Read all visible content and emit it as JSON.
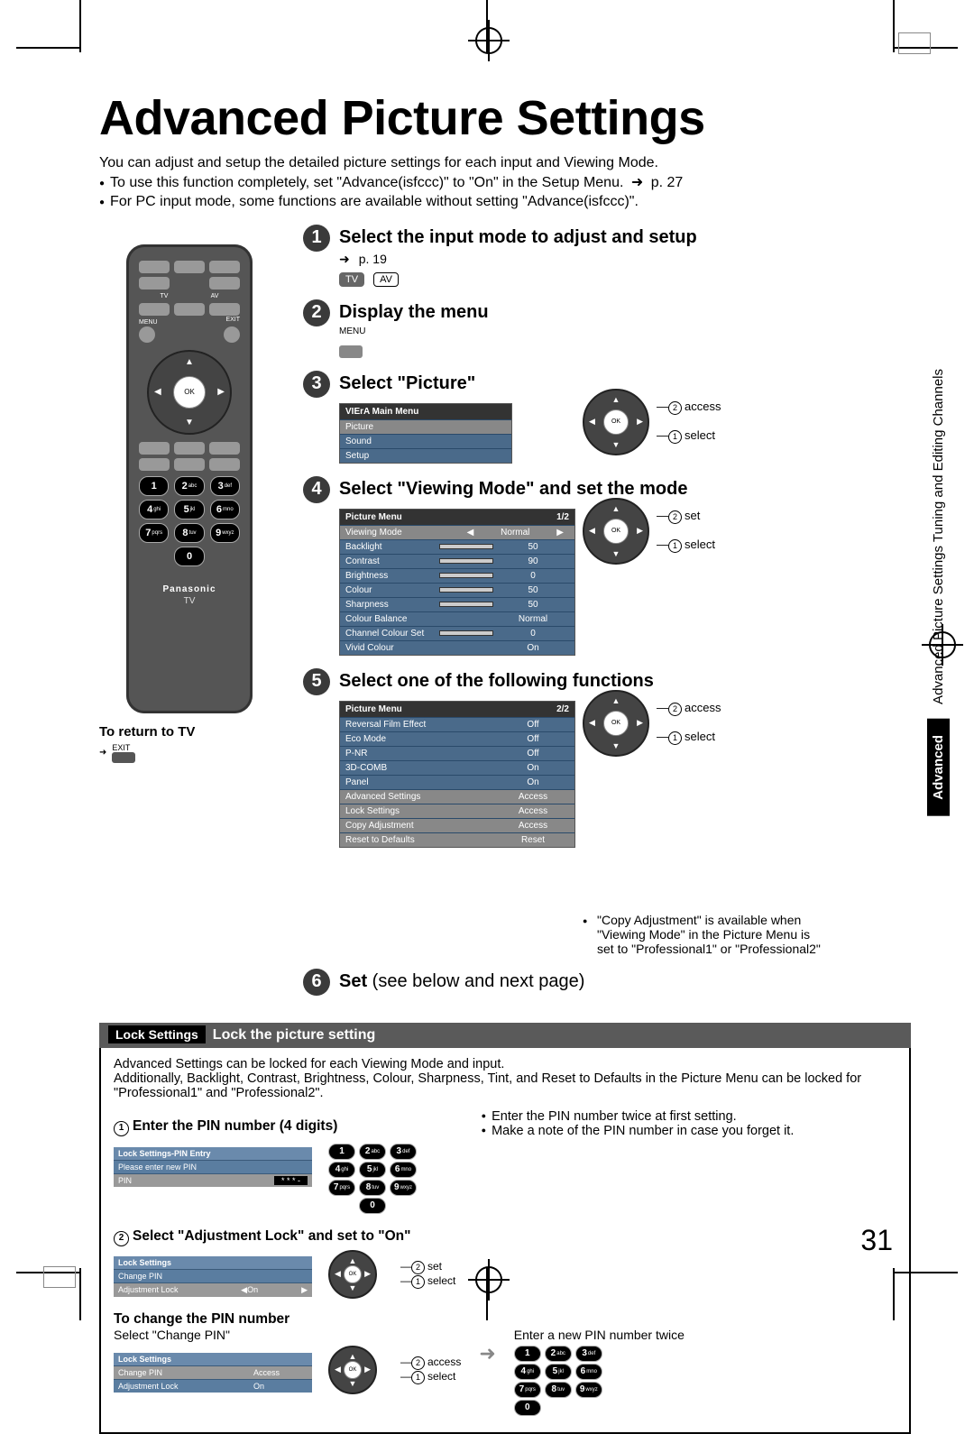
{
  "page_number": "31",
  "title": "Advanced Picture Settings",
  "intro": {
    "line1": "You can adjust and setup the detailed picture settings for each input and Viewing Mode.",
    "line2a": "To use this function completely, set \"Advance(isfccc)\" to \"On\" in the Setup Menu.",
    "line2b": "p. 27",
    "line3": "For PC input mode, some functions are available without setting \"Advance(isfccc)\"."
  },
  "side_tabs": {
    "t1": "Tuning and Editing Channels",
    "t2": "Advanced Picture Settings",
    "t3": "Advanced"
  },
  "remote": {
    "brand": "Panasonic",
    "model": "TV",
    "ok": "OK",
    "tv": "TV",
    "av": "AV",
    "menu": "MENU",
    "exit": "EXIT",
    "keys": [
      "1",
      "2abc",
      "3def",
      "4ghi",
      "5jkl",
      "6mno",
      "7pqrs",
      "8tuv",
      "9wxyz",
      "0"
    ],
    "return_label": "To return to TV",
    "exit_label": "EXIT"
  },
  "steps": {
    "s1": {
      "title": "Select the input mode to adjust and setup",
      "ref": "p. 19",
      "tv": "TV",
      "av": "AV"
    },
    "s2": {
      "title": "Display the menu",
      "menu": "MENU"
    },
    "s3": {
      "title": "Select \"Picture\"",
      "menu_title": "VIErA Main Menu",
      "items": [
        "Picture",
        "Sound",
        "Setup"
      ],
      "note_access": "access",
      "note_select": "select"
    },
    "s4": {
      "title": "Select \"Viewing Mode\" and set the mode",
      "menu_title": "Picture Menu",
      "page": "1/2",
      "rows": [
        {
          "k": "Viewing Mode",
          "v": "Normal",
          "sel": true
        },
        {
          "k": "Backlight",
          "v": "50"
        },
        {
          "k": "Contrast",
          "v": "90"
        },
        {
          "k": "Brightness",
          "v": "0"
        },
        {
          "k": "Colour",
          "v": "50"
        },
        {
          "k": "Sharpness",
          "v": "50"
        },
        {
          "k": "Colour Balance",
          "v": "Normal"
        },
        {
          "k": "Channel Colour Set",
          "v": "0"
        },
        {
          "k": "Vivid Colour",
          "v": "On"
        }
      ],
      "note_set": "set",
      "note_select": "select"
    },
    "s5": {
      "title": "Select one of the following functions",
      "menu_title": "Picture Menu",
      "page": "2/2",
      "rows": [
        {
          "k": "Reversal Film Effect",
          "v": "Off"
        },
        {
          "k": "Eco Mode",
          "v": "Off"
        },
        {
          "k": "P-NR",
          "v": "Off"
        },
        {
          "k": "3D-COMB",
          "v": "On"
        },
        {
          "k": "Panel",
          "v": "On"
        },
        {
          "k": "Advanced Settings",
          "v": "Access"
        },
        {
          "k": "Lock Settings",
          "v": "Access"
        },
        {
          "k": "Copy Adjustment",
          "v": "Access"
        },
        {
          "k": "Reset to Defaults",
          "v": "Reset"
        }
      ],
      "note_access": "access",
      "note_select": "select",
      "copy_note": "\"Copy Adjustment\" is available when \"Viewing Mode\" in the Picture Menu is set to \"Professional1\" or \"Professional2\""
    },
    "s6": {
      "title_a": "Set",
      "title_b": " (see below and next page)"
    }
  },
  "lock": {
    "tag": "Lock Settings",
    "title": "Lock the picture setting",
    "p1": "Advanced Settings can be locked for each Viewing Mode and input.",
    "p2": "Additionally, Backlight, Contrast, Brightness, Colour, Sharpness, Tint, and Reset to Defaults in the Picture Menu can be locked for \"Professional1\" and \"Professional2\".",
    "step1": "Enter the PIN number (4 digits)",
    "pin_box_title": "Lock Settings-PIN Entry",
    "pin_prompt": "Please enter new PIN",
    "pin_label": "PIN",
    "pin_mask": "* * * -",
    "bul1": "Enter the PIN number twice at first setting.",
    "bul2": "Make a note of the PIN number in case you forget it.",
    "step2": "Select \"Adjustment Lock\" and set to \"On\"",
    "ls_title": "Lock Settings",
    "ls_rows": [
      {
        "k": "Change PIN",
        "v": ""
      },
      {
        "k": "Adjustment Lock",
        "v": "On",
        "sel": true
      }
    ],
    "n_set": "set",
    "n_select": "select",
    "change_h": "To change the PIN number",
    "change_sel": "Select \"Change PIN\"",
    "ls2_rows": [
      {
        "k": "Change PIN",
        "v": "Access",
        "sel": true
      },
      {
        "k": "Adjustment Lock",
        "v": "On"
      }
    ],
    "n_access": "access",
    "enter_twice": "Enter a new PIN number twice"
  }
}
